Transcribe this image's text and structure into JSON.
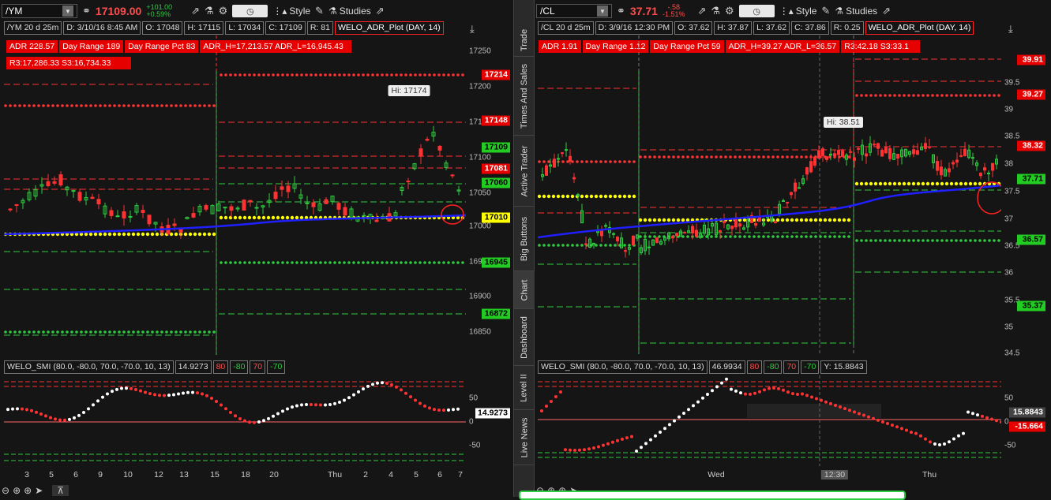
{
  "colors": {
    "red": "#ff3333",
    "green": "#2ecc40",
    "yellow": "#ffff00",
    "blue": "#1f1fff",
    "white": "#ffffff",
    "bg": "#151515"
  },
  "side_tabs": [
    "Trade",
    "Times And Sales",
    "Active Trader",
    "Big Buttons",
    "Chart",
    "Dashboard",
    "Level II",
    "Live News"
  ],
  "left": {
    "symbol": "/YM",
    "price": "17109.00",
    "change": "+101.00",
    "change_pct": "+0.59%",
    "style_label": "Style",
    "studies_label": "Studies",
    "info": {
      "desc": "/YM 20 d 25m",
      "date": "D: 3/10/16 8:45 AM",
      "open": "O: 17048",
      "high": "H: 17115",
      "low": "L: 17034",
      "close": "C: 17109",
      "range": "R: 81",
      "study": "WELO_ADR_Plot (DAY, 14)"
    },
    "labels_row1": [
      "ADR 228.57",
      "Day Range 189",
      "Day Range Pct 83",
      "ADR_H=17,213.57 ADR_L=16,945.43"
    ],
    "labels_row2": [
      "R3:17,286.33 S3:16,734.33"
    ],
    "hi_label": "Hi: 17174",
    "yticks": [
      "17250",
      "17200",
      "17150",
      "17100",
      "17050",
      "17000",
      "16950",
      "16900",
      "16850"
    ],
    "price_labels": [
      {
        "text": "17214",
        "color": "red"
      },
      {
        "text": "17148",
        "color": "red"
      },
      {
        "text": "17109",
        "color": "green"
      },
      {
        "text": "17081",
        "color": "red"
      },
      {
        "text": "17060",
        "color": "green"
      },
      {
        "text": "17010",
        "color": "yellow"
      },
      {
        "text": "16945",
        "color": "green"
      },
      {
        "text": "16872",
        "color": "green"
      }
    ],
    "xticks": [
      "3",
      "5",
      "6",
      "9",
      "10",
      "12",
      "13",
      "15",
      "18",
      "20",
      "Thu",
      "2",
      "4",
      "5",
      "6",
      "7"
    ],
    "osc": {
      "title": "WELO_SMI (80.0, -80.0, 70.0, -70.0, 10, 13)",
      "value": "14.9273",
      "l1": "80",
      "l2": "-80",
      "l3": "70",
      "l4": "-70",
      "yticks": [
        "50",
        "0",
        "-50"
      ],
      "label": "14.9273"
    }
  },
  "right": {
    "symbol": "/CL",
    "price": "37.71",
    "change": "-.58",
    "change_pct": "-1.51%",
    "style_label": "Style",
    "studies_label": "Studies",
    "info": {
      "desc": "/CL 20 d 25m",
      "date": "D: 3/9/16 12:30 PM",
      "open": "O: 37.62",
      "high": "H: 37.87",
      "low": "L: 37.62",
      "close": "C: 37.86",
      "range": "R: 0.25",
      "study": "WELO_ADR_Plot (DAY, 14)"
    },
    "labels_row1": [
      "ADR 1.91",
      "Day Range 1.12",
      "Day Range Pct 59",
      "ADR_H=39.27 ADR_L=36.57",
      "R3:42.18 S3:33.1"
    ],
    "hi_label": "Hi: 38.51",
    "yticks": [
      "39.5",
      "39",
      "38.5",
      "38",
      "37.5",
      "37",
      "36.5",
      "36",
      "35.5",
      "35",
      "34.5"
    ],
    "price_labels": [
      {
        "text": "39.91",
        "color": "red"
      },
      {
        "text": "39.27",
        "color": "red"
      },
      {
        "text": "38.32",
        "color": "red"
      },
      {
        "text": "37.71",
        "color": "green"
      },
      {
        "text": "36.57",
        "color": "green"
      },
      {
        "text": "35.37",
        "color": "green"
      }
    ],
    "xticks": [
      "Wed",
      "12:30",
      "Thu"
    ],
    "osc": {
      "title": "WELO_SMI (80.0, -80.0, 70.0, -70.0, 10, 13)",
      "value": "46.9934",
      "l1": "80",
      "l2": "-80",
      "l3": "70",
      "l4": "-70",
      "ylabel": "Y: 15.8843",
      "yticks": [
        "50",
        "0",
        "-50"
      ],
      "label1": "15.8843",
      "label2": "-15.664"
    }
  }
}
